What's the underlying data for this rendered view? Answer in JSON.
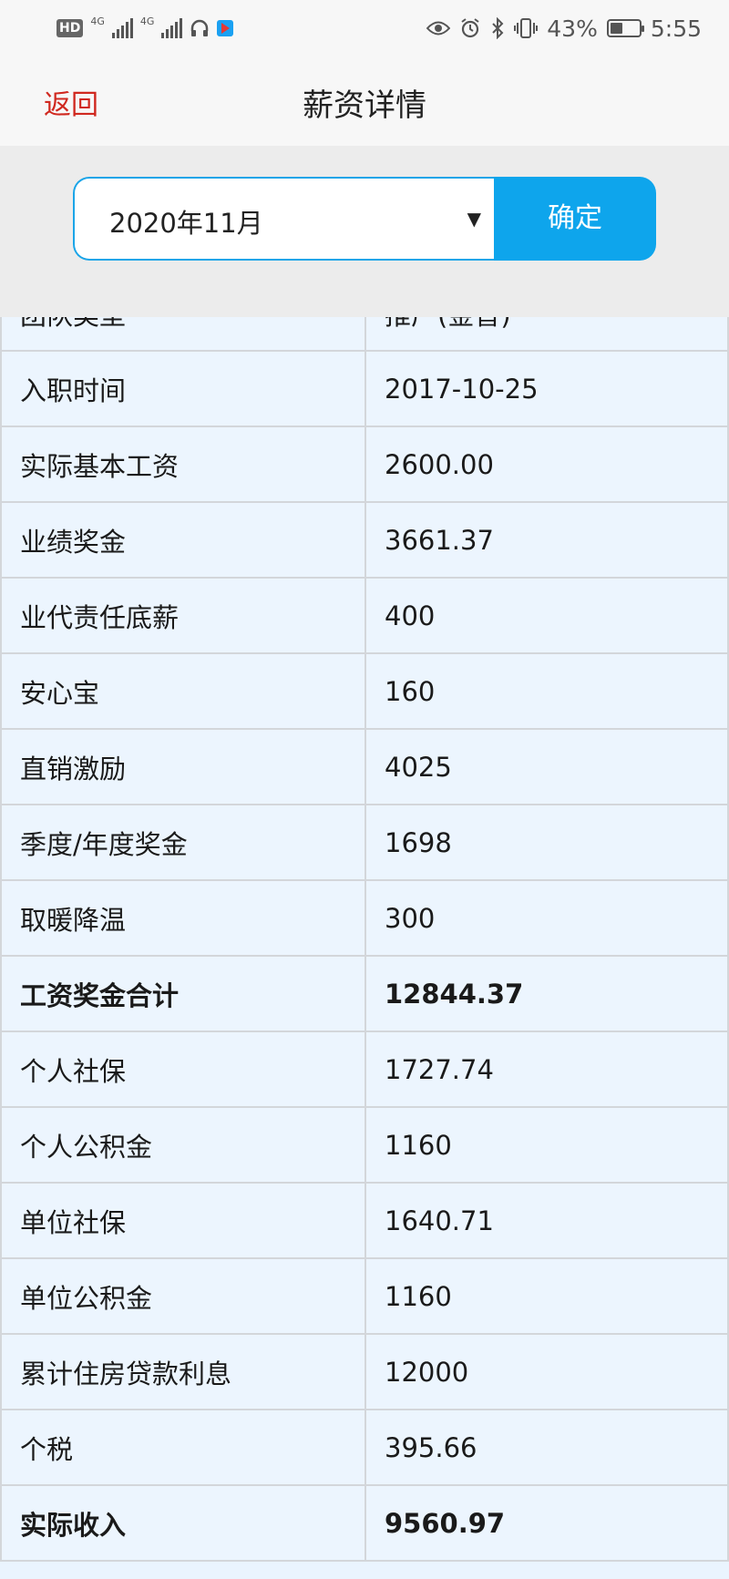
{
  "status_bar": {
    "left_badges": [
      "HD",
      "4G",
      "4G"
    ],
    "battery": "43%",
    "battery_level": 0.43,
    "time": "5:55",
    "icons": [
      "eye-icon",
      "alarm-icon",
      "bluetooth-icon",
      "vibrate-icon",
      "battery-icon"
    ]
  },
  "header": {
    "back_label": "返回",
    "title": "薪资详情"
  },
  "filter": {
    "month_value": "2020年11月",
    "caret": "▼",
    "confirm_label": "确定"
  },
  "rows": [
    {
      "label": "团队类型",
      "value": "推广(金普)",
      "bold": false
    },
    {
      "label": "入职时间",
      "value": "2017-10-25",
      "bold": false
    },
    {
      "label": "实际基本工资",
      "value": "2600.00",
      "bold": false
    },
    {
      "label": "业绩奖金",
      "value": "3661.37",
      "bold": false
    },
    {
      "label": "业代责任底薪",
      "value": "400",
      "bold": false
    },
    {
      "label": "安心宝",
      "value": "160",
      "bold": false
    },
    {
      "label": "直销激励",
      "value": "4025",
      "bold": false
    },
    {
      "label": "季度/年度奖金",
      "value": "1698",
      "bold": false
    },
    {
      "label": "取暖降温",
      "value": "300",
      "bold": false
    },
    {
      "label": "工资奖金合计",
      "value": "12844.37",
      "bold": true
    },
    {
      "label": "个人社保",
      "value": "1727.74",
      "bold": false
    },
    {
      "label": "个人公积金",
      "value": "1160",
      "bold": false
    },
    {
      "label": "单位社保",
      "value": "1640.71",
      "bold": false
    },
    {
      "label": "单位公积金",
      "value": "1160",
      "bold": false
    },
    {
      "label": "累计住房贷款利息",
      "value": "12000",
      "bold": false
    },
    {
      "label": "个税",
      "value": "395.66",
      "bold": false
    },
    {
      "label": "实际收入",
      "value": "9560.97",
      "bold": true
    }
  ]
}
